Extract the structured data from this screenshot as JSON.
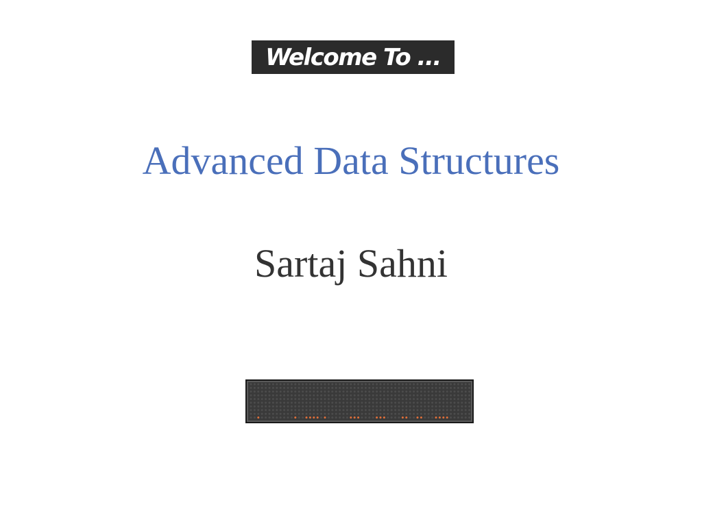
{
  "slide": {
    "welcome": "Welcome To ...",
    "title": "Advanced Data Structures",
    "author": "Sartaj Sahni"
  },
  "colors": {
    "title": "#4a6fba",
    "author": "#333333",
    "banner_bg": "#2b2b2b",
    "led_on": "#e0703a",
    "led_off": "#4c4c4c"
  }
}
